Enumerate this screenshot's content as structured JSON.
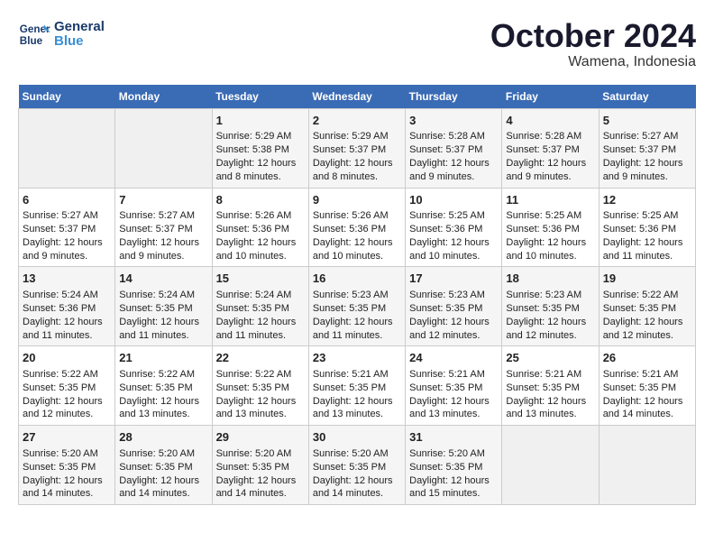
{
  "header": {
    "logo_line1": "General",
    "logo_line2": "Blue",
    "month": "October 2024",
    "location": "Wamena, Indonesia"
  },
  "weekdays": [
    "Sunday",
    "Monday",
    "Tuesday",
    "Wednesday",
    "Thursday",
    "Friday",
    "Saturday"
  ],
  "weeks": [
    [
      {
        "day": "",
        "sunrise": "",
        "sunset": "",
        "daylight": ""
      },
      {
        "day": "",
        "sunrise": "",
        "sunset": "",
        "daylight": ""
      },
      {
        "day": "1",
        "sunrise": "Sunrise: 5:29 AM",
        "sunset": "Sunset: 5:38 PM",
        "daylight": "Daylight: 12 hours and 8 minutes."
      },
      {
        "day": "2",
        "sunrise": "Sunrise: 5:29 AM",
        "sunset": "Sunset: 5:37 PM",
        "daylight": "Daylight: 12 hours and 8 minutes."
      },
      {
        "day": "3",
        "sunrise": "Sunrise: 5:28 AM",
        "sunset": "Sunset: 5:37 PM",
        "daylight": "Daylight: 12 hours and 9 minutes."
      },
      {
        "day": "4",
        "sunrise": "Sunrise: 5:28 AM",
        "sunset": "Sunset: 5:37 PM",
        "daylight": "Daylight: 12 hours and 9 minutes."
      },
      {
        "day": "5",
        "sunrise": "Sunrise: 5:27 AM",
        "sunset": "Sunset: 5:37 PM",
        "daylight": "Daylight: 12 hours and 9 minutes."
      }
    ],
    [
      {
        "day": "6",
        "sunrise": "Sunrise: 5:27 AM",
        "sunset": "Sunset: 5:37 PM",
        "daylight": "Daylight: 12 hours and 9 minutes."
      },
      {
        "day": "7",
        "sunrise": "Sunrise: 5:27 AM",
        "sunset": "Sunset: 5:37 PM",
        "daylight": "Daylight: 12 hours and 9 minutes."
      },
      {
        "day": "8",
        "sunrise": "Sunrise: 5:26 AM",
        "sunset": "Sunset: 5:36 PM",
        "daylight": "Daylight: 12 hours and 10 minutes."
      },
      {
        "day": "9",
        "sunrise": "Sunrise: 5:26 AM",
        "sunset": "Sunset: 5:36 PM",
        "daylight": "Daylight: 12 hours and 10 minutes."
      },
      {
        "day": "10",
        "sunrise": "Sunrise: 5:25 AM",
        "sunset": "Sunset: 5:36 PM",
        "daylight": "Daylight: 12 hours and 10 minutes."
      },
      {
        "day": "11",
        "sunrise": "Sunrise: 5:25 AM",
        "sunset": "Sunset: 5:36 PM",
        "daylight": "Daylight: 12 hours and 10 minutes."
      },
      {
        "day": "12",
        "sunrise": "Sunrise: 5:25 AM",
        "sunset": "Sunset: 5:36 PM",
        "daylight": "Daylight: 12 hours and 11 minutes."
      }
    ],
    [
      {
        "day": "13",
        "sunrise": "Sunrise: 5:24 AM",
        "sunset": "Sunset: 5:36 PM",
        "daylight": "Daylight: 12 hours and 11 minutes."
      },
      {
        "day": "14",
        "sunrise": "Sunrise: 5:24 AM",
        "sunset": "Sunset: 5:35 PM",
        "daylight": "Daylight: 12 hours and 11 minutes."
      },
      {
        "day": "15",
        "sunrise": "Sunrise: 5:24 AM",
        "sunset": "Sunset: 5:35 PM",
        "daylight": "Daylight: 12 hours and 11 minutes."
      },
      {
        "day": "16",
        "sunrise": "Sunrise: 5:23 AM",
        "sunset": "Sunset: 5:35 PM",
        "daylight": "Daylight: 12 hours and 11 minutes."
      },
      {
        "day": "17",
        "sunrise": "Sunrise: 5:23 AM",
        "sunset": "Sunset: 5:35 PM",
        "daylight": "Daylight: 12 hours and 12 minutes."
      },
      {
        "day": "18",
        "sunrise": "Sunrise: 5:23 AM",
        "sunset": "Sunset: 5:35 PM",
        "daylight": "Daylight: 12 hours and 12 minutes."
      },
      {
        "day": "19",
        "sunrise": "Sunrise: 5:22 AM",
        "sunset": "Sunset: 5:35 PM",
        "daylight": "Daylight: 12 hours and 12 minutes."
      }
    ],
    [
      {
        "day": "20",
        "sunrise": "Sunrise: 5:22 AM",
        "sunset": "Sunset: 5:35 PM",
        "daylight": "Daylight: 12 hours and 12 minutes."
      },
      {
        "day": "21",
        "sunrise": "Sunrise: 5:22 AM",
        "sunset": "Sunset: 5:35 PM",
        "daylight": "Daylight: 12 hours and 13 minutes."
      },
      {
        "day": "22",
        "sunrise": "Sunrise: 5:22 AM",
        "sunset": "Sunset: 5:35 PM",
        "daylight": "Daylight: 12 hours and 13 minutes."
      },
      {
        "day": "23",
        "sunrise": "Sunrise: 5:21 AM",
        "sunset": "Sunset: 5:35 PM",
        "daylight": "Daylight: 12 hours and 13 minutes."
      },
      {
        "day": "24",
        "sunrise": "Sunrise: 5:21 AM",
        "sunset": "Sunset: 5:35 PM",
        "daylight": "Daylight: 12 hours and 13 minutes."
      },
      {
        "day": "25",
        "sunrise": "Sunrise: 5:21 AM",
        "sunset": "Sunset: 5:35 PM",
        "daylight": "Daylight: 12 hours and 13 minutes."
      },
      {
        "day": "26",
        "sunrise": "Sunrise: 5:21 AM",
        "sunset": "Sunset: 5:35 PM",
        "daylight": "Daylight: 12 hours and 14 minutes."
      }
    ],
    [
      {
        "day": "27",
        "sunrise": "Sunrise: 5:20 AM",
        "sunset": "Sunset: 5:35 PM",
        "daylight": "Daylight: 12 hours and 14 minutes."
      },
      {
        "day": "28",
        "sunrise": "Sunrise: 5:20 AM",
        "sunset": "Sunset: 5:35 PM",
        "daylight": "Daylight: 12 hours and 14 minutes."
      },
      {
        "day": "29",
        "sunrise": "Sunrise: 5:20 AM",
        "sunset": "Sunset: 5:35 PM",
        "daylight": "Daylight: 12 hours and 14 minutes."
      },
      {
        "day": "30",
        "sunrise": "Sunrise: 5:20 AM",
        "sunset": "Sunset: 5:35 PM",
        "daylight": "Daylight: 12 hours and 14 minutes."
      },
      {
        "day": "31",
        "sunrise": "Sunrise: 5:20 AM",
        "sunset": "Sunset: 5:35 PM",
        "daylight": "Daylight: 12 hours and 15 minutes."
      },
      {
        "day": "",
        "sunrise": "",
        "sunset": "",
        "daylight": ""
      },
      {
        "day": "",
        "sunrise": "",
        "sunset": "",
        "daylight": ""
      }
    ]
  ]
}
